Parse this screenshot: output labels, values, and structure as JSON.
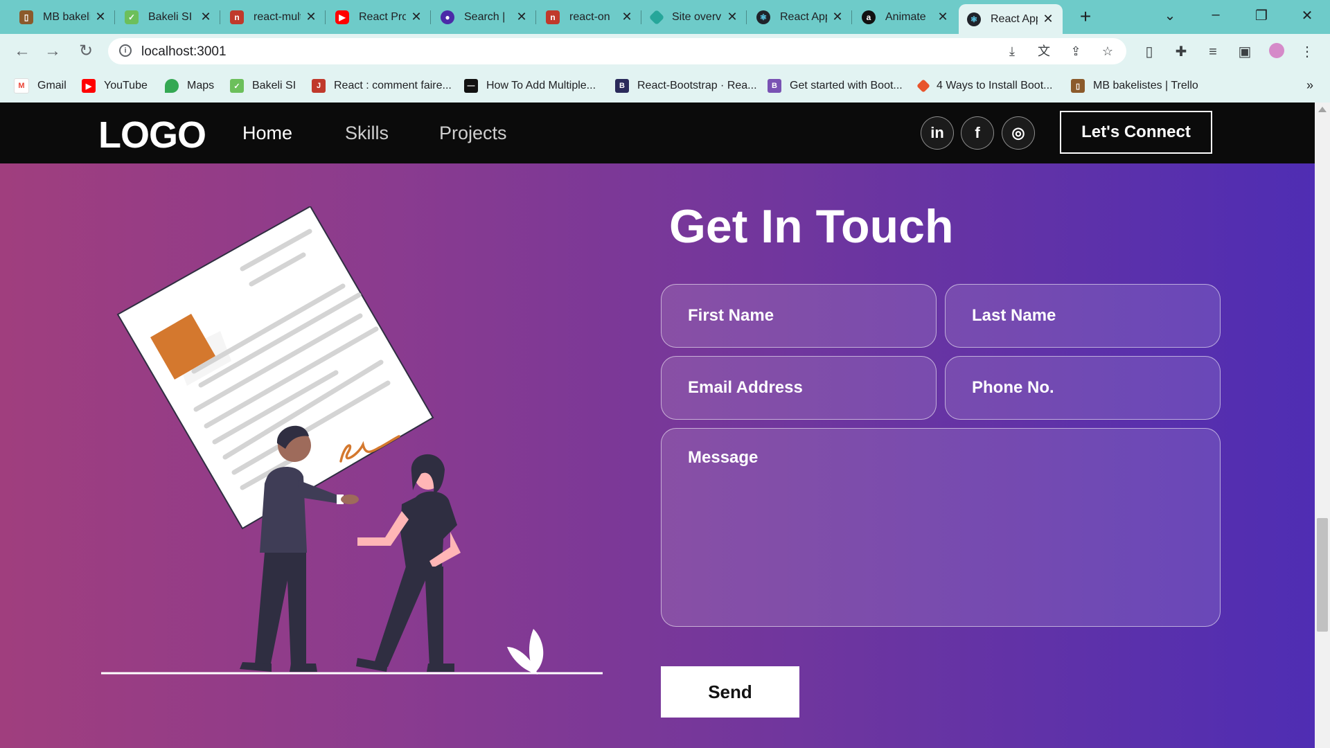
{
  "browser": {
    "tabs": [
      {
        "title": "MB bakelistes",
        "icon_color": "#8b5a2b",
        "icon": "trello-icon"
      },
      {
        "title": "Bakeli SI",
        "icon_color": "#6cbf5b",
        "icon": "bakeli-icon"
      },
      {
        "title": "react-multi",
        "icon_color": "#c0392b",
        "icon": "npm-icon"
      },
      {
        "title": "React Pro",
        "icon_color": "#ff0000",
        "icon": "youtube-icon"
      },
      {
        "title": "Search |",
        "icon_color": "#4b2ba8",
        "icon": "search-icon"
      },
      {
        "title": "react-on",
        "icon_color": "#c0392b",
        "icon": "npm-icon"
      },
      {
        "title": "Site overview",
        "icon_color": "#26a69a",
        "icon": "netlify-icon"
      },
      {
        "title": "React App",
        "icon_color": "#20232a",
        "icon": "react-icon"
      },
      {
        "title": "Animate",
        "icon_color": "#111111",
        "icon": "animate-icon"
      },
      {
        "title": "React App",
        "icon_color": "#20232a",
        "icon": "react-icon"
      }
    ],
    "active_tab": 9,
    "url": "localhost:3001",
    "bookmarks": [
      {
        "label": "Gmail",
        "color": "#ea4335",
        "icon": "gmail-icon"
      },
      {
        "label": "YouTube",
        "color": "#ff0000",
        "icon": "youtube-icon"
      },
      {
        "label": "Maps",
        "color": "#34a853",
        "icon": "maps-icon"
      },
      {
        "label": "Bakeli SI",
        "color": "#6cbf5b",
        "icon": "bakeli-icon"
      },
      {
        "label": "React : comment faire...",
        "color": "#c0392b",
        "icon": "bookmark-icon"
      },
      {
        "label": "How To Add Multiple...",
        "color": "#111111",
        "icon": "bookmark-icon"
      },
      {
        "label": "React-Bootstrap · Rea...",
        "color": "#2a2a5a",
        "icon": "bootstrap-icon"
      },
      {
        "label": "Get started with Boot...",
        "color": "#7952b3",
        "icon": "bootstrap-icon"
      },
      {
        "label": "4 Ways to Install Boot...",
        "color": "#e8542c",
        "icon": "bookmark-icon"
      },
      {
        "label": "MB bakelistes | Trello",
        "color": "#8b5a2b",
        "icon": "trello-icon"
      }
    ]
  },
  "site": {
    "logo": "LOGO",
    "nav": [
      "Home",
      "Skills",
      "Projects"
    ],
    "social": [
      "in",
      "f",
      "◎"
    ],
    "connect_label": "Let's Connect",
    "contact": {
      "title": "Get In Touch",
      "first_name": "First Name",
      "last_name": "Last Name",
      "email": "Email Address",
      "phone": "Phone No.",
      "message": "Message",
      "send_label": "Send"
    }
  },
  "colors": {
    "tab_strip": "#6ecbc9",
    "toolbar": "#e2f3f2",
    "gradient_start": "#a03e7e",
    "gradient_end": "#4f2db3",
    "accent_orange": "#d4782e"
  }
}
